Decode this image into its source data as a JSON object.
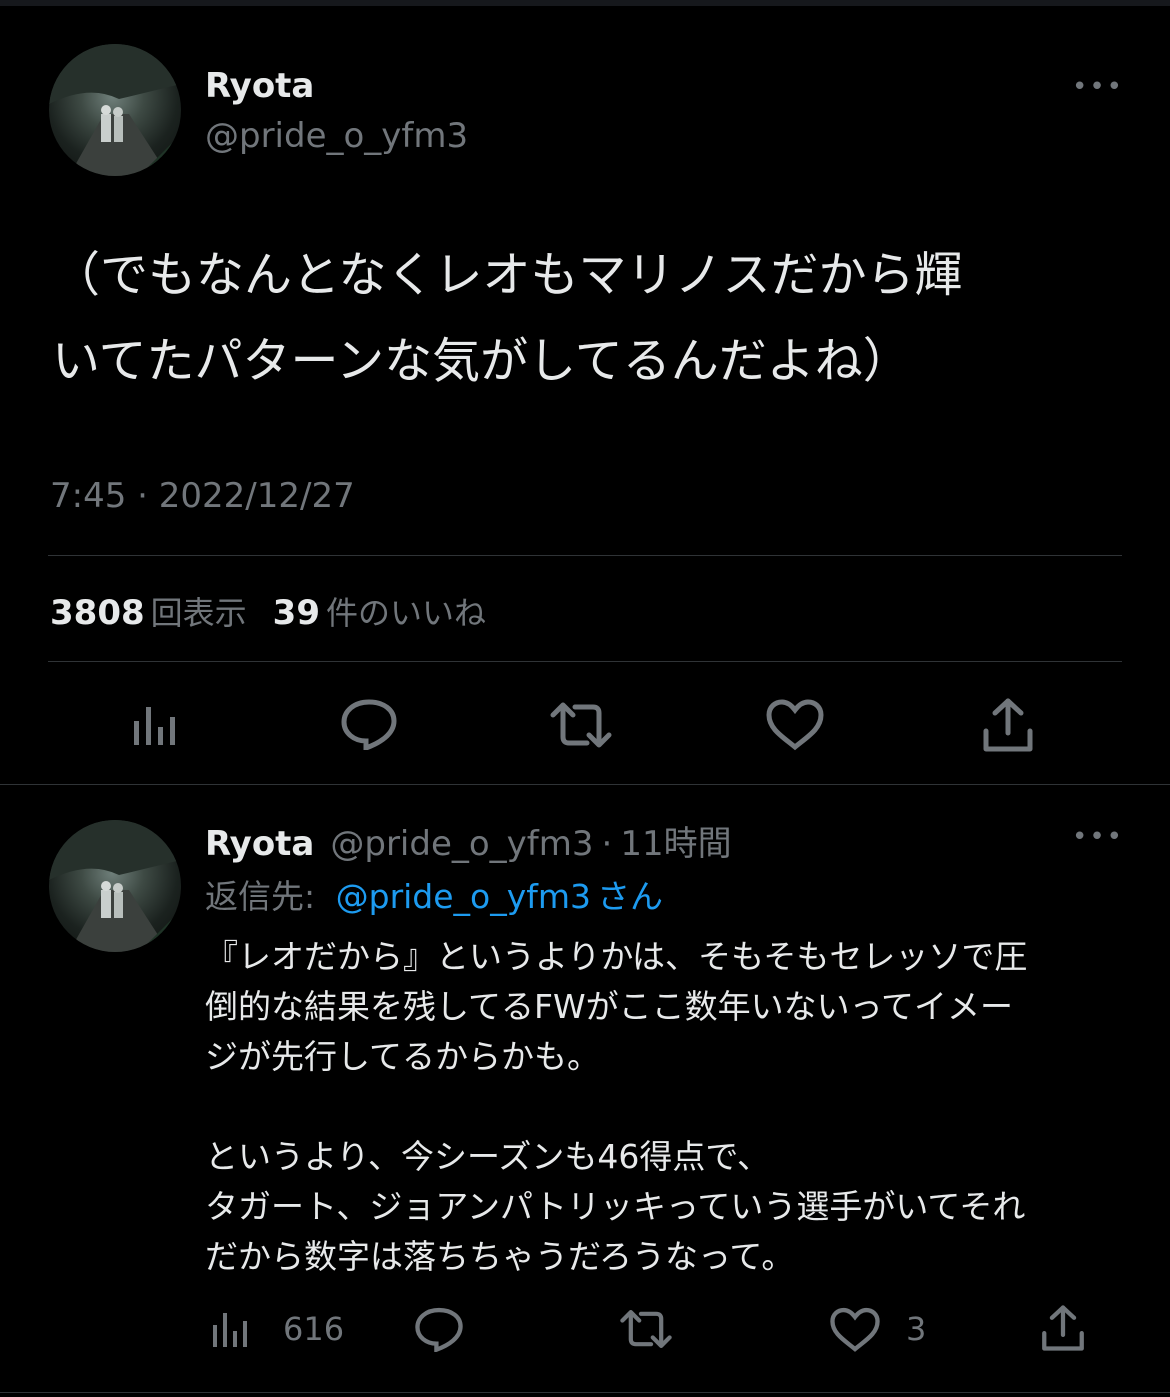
{
  "main_tweet": {
    "display_name": "Ryota",
    "handle": "@pride_o_yfm3",
    "text_line1": "（でもなんとなくレオもマリノスだから輝",
    "text_line2": "いてたパターンな気がしてるんだよね）",
    "timestamp": "7:45 · 2022/12/27",
    "views_count": "3808",
    "views_label": "回表示",
    "likes_count": "39",
    "likes_label": "件のいいね",
    "more_label": "•••"
  },
  "reply_tweet": {
    "display_name": "Ryota",
    "handle": "@pride_o_yfm3",
    "separator": "·",
    "time_ago": "11時間",
    "reply_prefix": "返信先:",
    "reply_to": "@pride_o_yfm3",
    "reply_suffix": "さん",
    "text": "『レオだから』というよりかは、そもそもセレッソで圧\n倒的な結果を残してるFWがここ数年いないってイメー\nジが先行してるからかも。\n\nというより、今シーズンも46得点で、\nタガート、ジョアンパトリッキっていう選手がいてそれ\nだから数字は落ちちゃうだろうなって。",
    "views_count": "616",
    "likes_count": "3",
    "more_label": "•••"
  },
  "icons": [
    "analytics-icon",
    "reply-icon",
    "retweet-icon",
    "like-icon",
    "share-icon",
    "more-icon"
  ],
  "colors": {
    "background": "#000000",
    "text": "#e7e9ea",
    "muted": "#71767b",
    "link": "#1d9bf0",
    "divider": "#2f3336"
  }
}
